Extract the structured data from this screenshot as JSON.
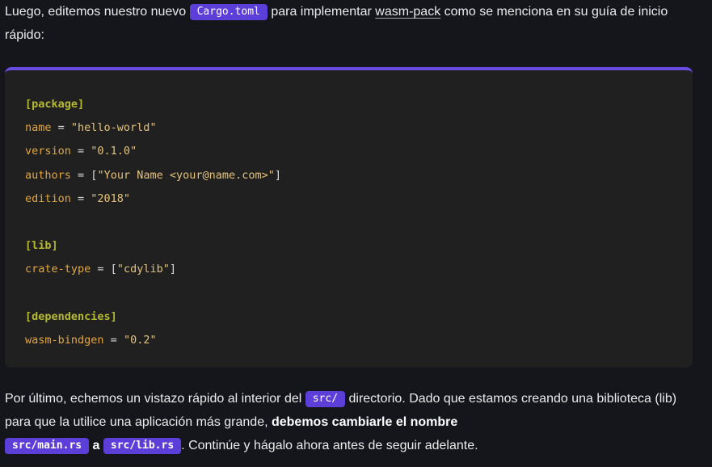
{
  "intro": {
    "t1": "Luego, editemos nuestro nuevo ",
    "code": "Cargo.toml",
    "t2": " para implementar ",
    "link": "wasm-pack",
    "t3": " como se menciona en su guía de inicio rápido:"
  },
  "codeblock": {
    "package_header": "[package]",
    "name_key": "name",
    "name_val": "\"hello-world\"",
    "version_key": "version",
    "version_val": "\"0.1.0\"",
    "authors_key": "authors",
    "authors_open": "[",
    "authors_val": "\"Your Name <your@name.com>\"",
    "authors_close": "]",
    "edition_key": "edition",
    "edition_val": "\"2018\"",
    "lib_header": "[lib]",
    "crate_key": "crate-type",
    "crate_open": "[",
    "crate_val": "\"cdylib\"",
    "crate_close": "]",
    "deps_header": "[dependencies]",
    "wasm_key": "wasm-bindgen",
    "wasm_val": "\"0.2\"",
    "eq": " = "
  },
  "outro": {
    "t1": "Por último, echemos un vistazo rápido al interior del ",
    "code1": "src/",
    "t2": " directorio. Dado que estamos creando una biblioteca (lib) para que la utilice una aplicación más grande, ",
    "bold": "debemos cambiarle el nombre",
    "code2": "src/main.rs",
    "t3": " a ",
    "code3": "src/lib.rs",
    "t4": ". Continúe y hágalo ahora antes de seguir adelante."
  },
  "colors": {
    "accent": "#5c3fd9",
    "background": "#15161c",
    "code_bg": "#202020"
  }
}
